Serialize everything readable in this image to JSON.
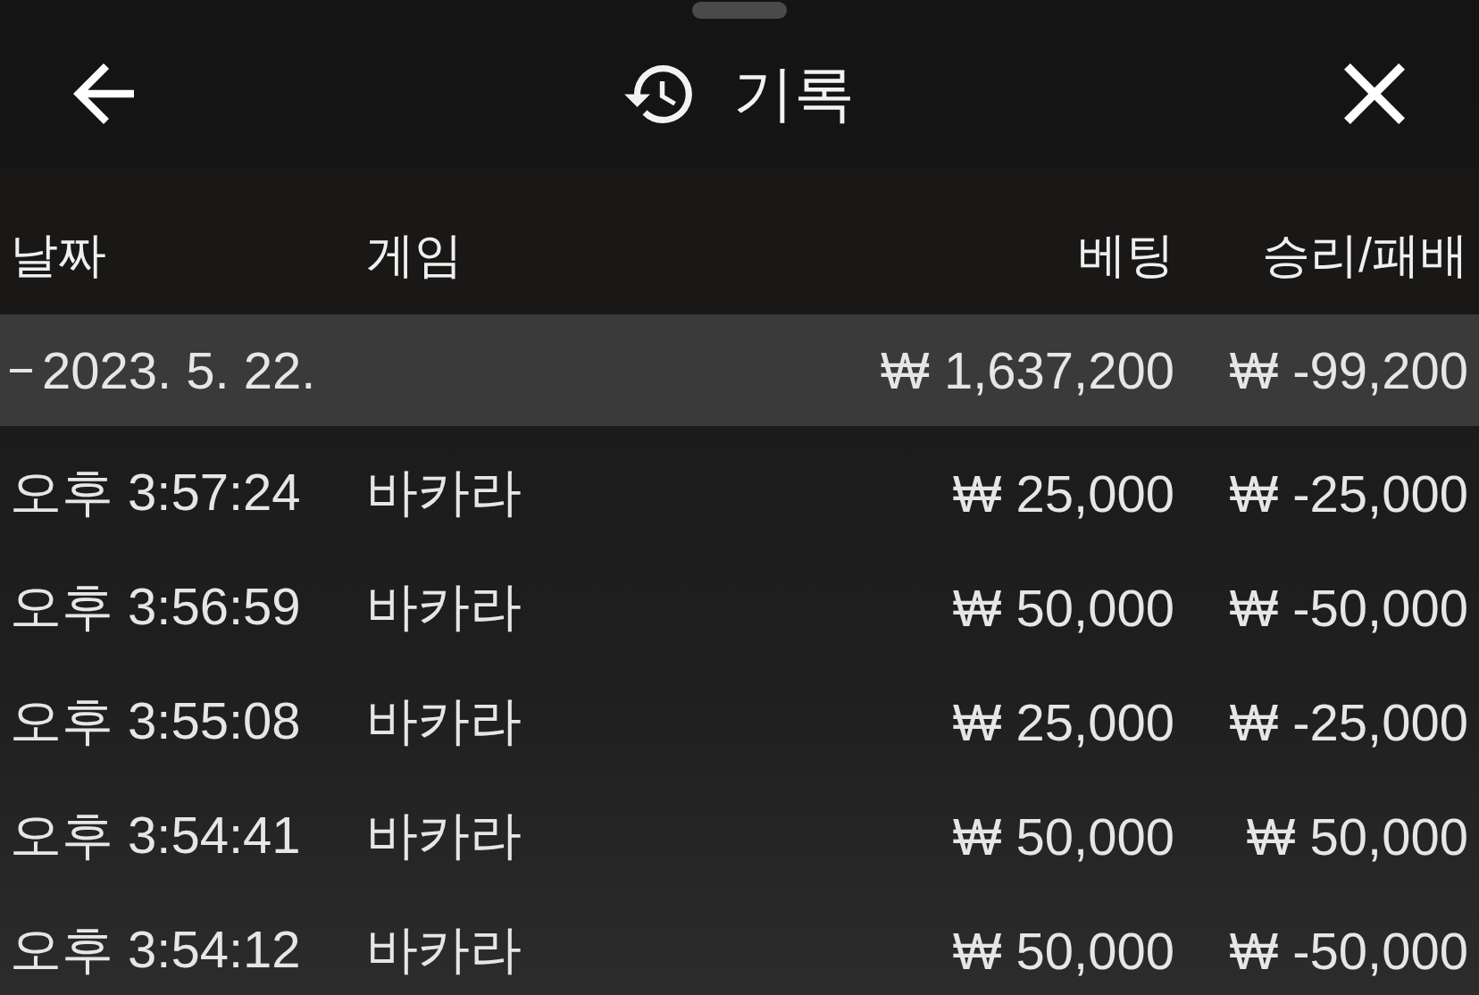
{
  "header": {
    "title": "기록"
  },
  "table": {
    "columns": [
      "날짜",
      "게임",
      "베팅",
      "승리/패배"
    ],
    "groups": [
      {
        "date": "2023. 5. 22.",
        "expanded": true,
        "bet": "₩ 1,637,200",
        "result": "₩ -99,200",
        "rows": [
          {
            "time": "오후 3:57:24",
            "game": "바카라",
            "bet": "₩ 25,000",
            "result": "₩ -25,000"
          },
          {
            "time": "오후 3:56:59",
            "game": "바카라",
            "bet": "₩ 50,000",
            "result": "₩ -50,000"
          },
          {
            "time": "오후 3:55:08",
            "game": "바카라",
            "bet": "₩ 25,000",
            "result": "₩ -25,000"
          },
          {
            "time": "오후 3:54:41",
            "game": "바카라",
            "bet": "₩ 50,000",
            "result": "₩ 50,000"
          },
          {
            "time": "오후 3:54:12",
            "game": "바카라",
            "bet": "₩ 50,000",
            "result": "₩ -50,000"
          }
        ]
      }
    ]
  }
}
